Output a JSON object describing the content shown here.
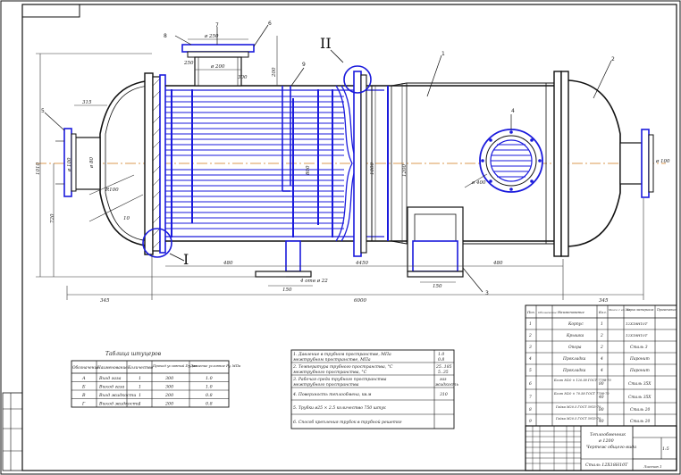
{
  "drawing": {
    "view_label_top": "II",
    "view_label_bottom": "I",
    "callouts": [
      "1",
      "2",
      "3",
      "4",
      "5",
      "6",
      "7",
      "8",
      "9"
    ],
    "dimensions": {
      "d_top_nozzle": "ø 250",
      "d_top_nozzle_inner": "ø 200",
      "h_top": "200",
      "d_left_flange": "ø 100",
      "d_left_pipe": "ø 80",
      "len_345_left": "345",
      "len_6000": "6000",
      "len_345_right": "345",
      "len_480_left": "480",
      "len_4450": "4450",
      "len_480_right": "480",
      "len_150_a": "150",
      "len_150_b": "150",
      "h_1010": "1010",
      "h_200_r": "200",
      "h_720": "720",
      "d_800": "800",
      "d_1200": "1200",
      "d_1000": "1000",
      "thk_20": "4 отв ø 22",
      "r_100": "R100",
      "s_10": "10",
      "d_300": "300",
      "rl_ladder": "250",
      "d_manhole": "ø 400",
      "right_d": "ø 100",
      "left_315": "315"
    }
  },
  "nozzle_table": {
    "title": "Таблица штуцеров",
    "headers": [
      "Обозначение",
      "Наименование",
      "Количество",
      "Проход условный Dy, мм",
      "Давление условное Py, МПа"
    ],
    "rows": [
      [
        "А",
        "Вход газа",
        "1",
        "300",
        "1.0"
      ],
      [
        "Б",
        "Выход газа",
        "1",
        "300",
        "1.0"
      ],
      [
        "В",
        "Вход жидкости",
        "1",
        "200",
        "0.8"
      ],
      [
        "Г",
        "Выход жидкости",
        "1",
        "200",
        "0.8"
      ]
    ]
  },
  "tech_table": {
    "rows": [
      [
        "1. Давление в трубном пространстве, МПа",
        "1.0"
      ],
      [
        "    межтрубном пространстве, МПа",
        "0.8"
      ],
      [
        "2. Температура трубного пространства, °С",
        "25..185"
      ],
      [
        "    межтрубного пространства, °С",
        "5..35"
      ],
      [
        "3. Рабочая среда трубного пространства",
        "газ"
      ],
      [
        "    межтрубного пространства",
        "жидкость"
      ],
      [
        "4. Поверхность теплообмена, кв.м",
        "310"
      ],
      [
        "5. Трубки ø25 × 2.5 количество 750 штук",
        ""
      ],
      [
        "6. Способ крепления трубок в трубной решетке",
        ""
      ]
    ]
  },
  "spec_table": {
    "headers": [
      "Поз.",
      "Обозначение",
      "Наименование",
      "Кол.",
      "Масса 1 ед., кг",
      "Марка материала",
      "Примечание"
    ],
    "rows": [
      [
        "1",
        "",
        "Корпус",
        "1",
        "",
        "12Х18Н10Т",
        ""
      ],
      [
        "2",
        "",
        "Крышка",
        "2",
        "",
        "12Х18Н10Т",
        ""
      ],
      [
        "3",
        "",
        "Опора",
        "2",
        "",
        "Сталь 3",
        ""
      ],
      [
        "4",
        "",
        "Прокладка",
        "4",
        "",
        "Паронит",
        ""
      ],
      [
        "5",
        "",
        "Прокладка",
        "4",
        "",
        "Паронит",
        ""
      ],
      [
        "6",
        "",
        "Болт М20 × 120.58 ГОСТ 7798-70",
        "80",
        "",
        "Сталь 35Х",
        ""
      ],
      [
        "7",
        "",
        "Болт М20 × 70.58 ГОСТ 7798-70",
        "40",
        "",
        "Сталь 35Х",
        ""
      ],
      [
        "8",
        "",
        "Гайка М20.5 ГОСТ 5915-70",
        "80",
        "",
        "Сталь 20",
        ""
      ],
      [
        "9",
        "",
        "Гайка М20.5 ГОСТ 5915-70",
        "40",
        "",
        "Сталь 20",
        ""
      ]
    ]
  },
  "title_block": {
    "name_line1": "Теплообменник",
    "name_line2": "ø 1200",
    "name_line3": "Чертеж общего вида",
    "material": "Сталь 12Х18Н10Т",
    "scale": "1:5",
    "sheet": "Листов 1"
  },
  "colors": {
    "blue": "#1a1adc",
    "line": "#111111",
    "centerline": "#d07a1a",
    "dim": "#333333"
  }
}
